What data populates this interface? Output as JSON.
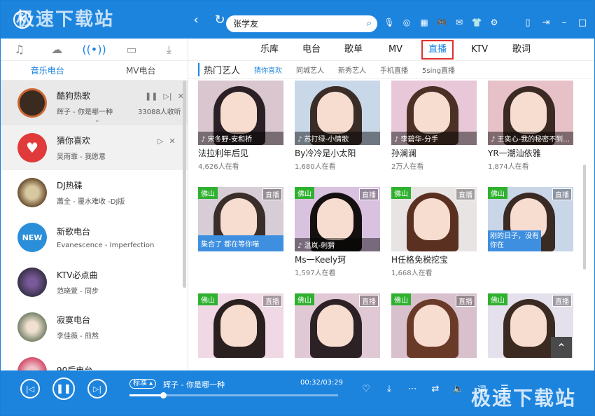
{
  "window": {
    "logo_text": "K",
    "watermark": "极速下载站",
    "back_icon": "back-arrow-icon",
    "refresh_icon": "refresh-icon"
  },
  "search": {
    "value": "张学友"
  },
  "left": {
    "sub_tabs": [
      "音乐电台",
      "MV电台"
    ],
    "stations": [
      {
        "name": "酷狗热歌",
        "sub": "辉子 - 你是哪一种",
        "count": "33088人收听",
        "color": "#3a2a20"
      },
      {
        "name": "猜你喜欢",
        "sub": "吴雨霏 - 我愿意",
        "count": "",
        "color": "#e03a3a"
      },
      {
        "name": "DJ热碟",
        "sub": "蕭全 - 覆水难收 -DJ版",
        "count": "",
        "color": "#8a6b40"
      },
      {
        "name": "新歌电台",
        "sub": "Evanescence - Imperfection",
        "count": "",
        "color": "#2a8ed8"
      },
      {
        "name": "KTV必点曲",
        "sub": "范晓萱 - 同步",
        "count": "",
        "color": "#4a3a5a"
      },
      {
        "name": "寂寞电台",
        "sub": "李佳薇 - 煎熬",
        "count": "",
        "color": "#6a7a60"
      },
      {
        "name": "90后电台",
        "sub": "",
        "count": "",
        "color": "#d04060"
      }
    ]
  },
  "right": {
    "nav": [
      "乐库",
      "电台",
      "歌单",
      "MV",
      "直播",
      "KTV",
      "歌词"
    ],
    "section_title": "热门艺人",
    "filters": [
      "猜你喜欢",
      "同城艺人",
      "新秀艺人",
      "手机直播",
      "5sing直播"
    ],
    "cards": [
      {
        "title": "法拉利年后见",
        "viewers": "4,626人在看",
        "song": "♪ 宋冬野-安和桥",
        "badge": "",
        "live": "",
        "bg": "#d9c6cf",
        "hair": "#2a2025"
      },
      {
        "title": "By冷冷是小太阳",
        "viewers": "1,680人在看",
        "song": "♪ 苏打绿-小情歌",
        "badge": "",
        "live": "",
        "bg": "#c9d8e8",
        "hair": "#3a2c26"
      },
      {
        "title": "孙澜澜",
        "viewers": "2万人在看",
        "song": "♪ 李碧华-分手",
        "badge": "",
        "live": "",
        "bg": "#e8c8d8",
        "hair": "#4a3025"
      },
      {
        "title": "YR一潮汕依雅",
        "viewers": "1,874人在看",
        "song": "♪ 王奕心-我的秘密不到…",
        "badge": "",
        "live": "",
        "bg": "#e6c2c8",
        "hair": "#3b2a24"
      },
      {
        "title": "",
        "viewers": "",
        "song": "集合了 都在等你喵",
        "badge": "佛山",
        "live": "直播",
        "bg": "#d6cdd6",
        "hair": "#3a2e2a"
      },
      {
        "title": "Ms一Keely珂",
        "viewers": "1,597人在看",
        "song": "♪ 温岚-刺猬",
        "badge": "佛山",
        "live": "直播",
        "bg": "#d8c2e0",
        "hair": "#151010"
      },
      {
        "title": "H任格免税挖宝",
        "viewers": "1,668人在看",
        "song": "",
        "badge": "佛山",
        "live": "直播",
        "bg": "#e8e4e4",
        "hair": "#5a3020"
      },
      {
        "title": "",
        "viewers": "",
        "song": "刚的日子，没有你在",
        "badge": "佛山",
        "live": "直播",
        "bg": "#c9d6e8",
        "hair": "#3a2a24"
      },
      {
        "title": "",
        "viewers": "",
        "song": "",
        "badge": "佛山",
        "live": "直播",
        "bg": "#f0d8e4",
        "hair": "#2a2020"
      },
      {
        "title": "",
        "viewers": "",
        "song": "",
        "badge": "佛山",
        "live": "直播",
        "bg": "#e0c8d4",
        "hair": "#2c2226"
      },
      {
        "title": "",
        "viewers": "",
        "song": "",
        "badge": "佛山",
        "live": "直播",
        "bg": "#d8c0cc",
        "hair": "#6a3a28"
      },
      {
        "title": "",
        "viewers": "",
        "song": "",
        "badge": "佛山",
        "live": "直播",
        "bg": "#e4e0ec",
        "hair": "#3a2a22"
      }
    ],
    "card6_overlay": "H任格免税挖宝 护"
  },
  "player": {
    "quality": "标准",
    "track": "辉子 - 你是哪一种",
    "time": "00:32/03:29",
    "progress": 0.16
  }
}
